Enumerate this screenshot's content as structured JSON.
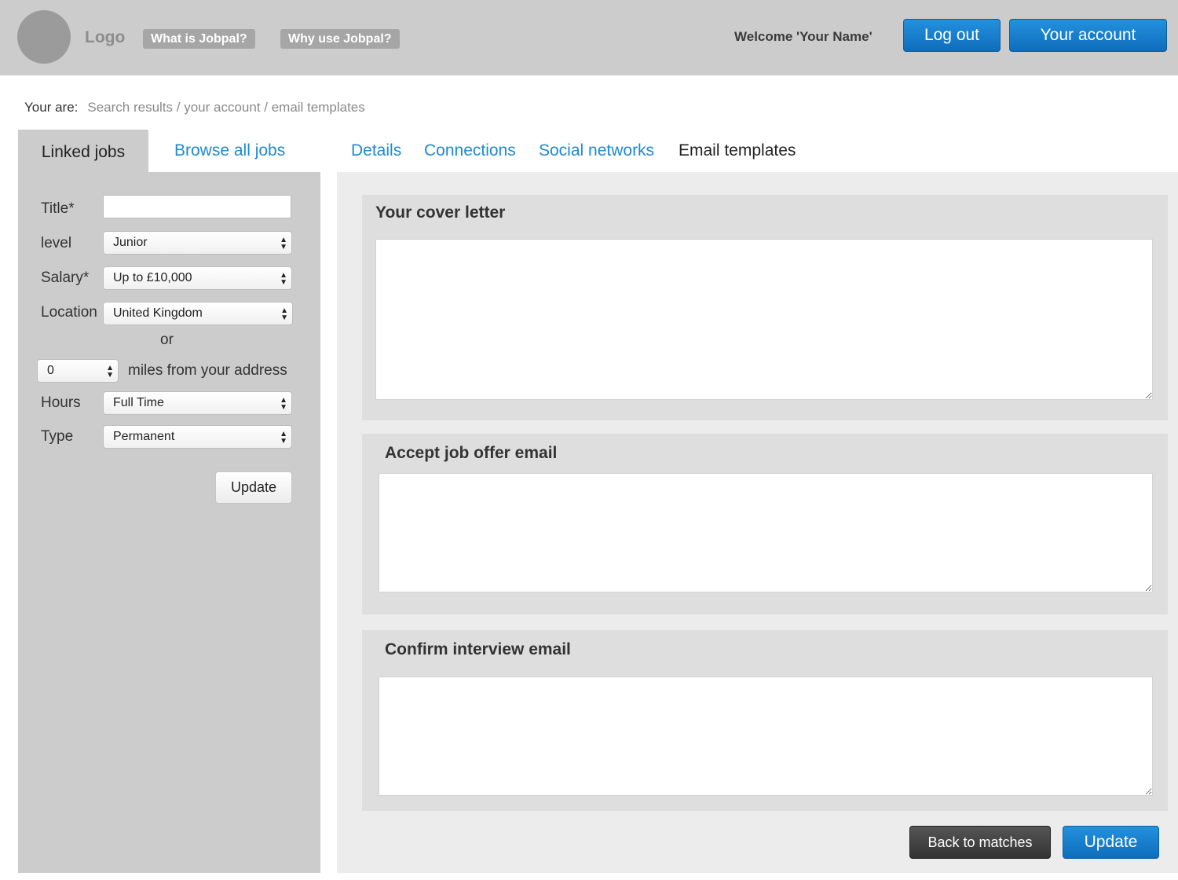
{
  "header": {
    "logo": "Logo",
    "nav": [
      "What is Jobpal?",
      "Why use Jobpal?"
    ],
    "welcome": "Welcome 'Your Name'",
    "logout": "Log out",
    "account": "Your account"
  },
  "breadcrumb": {
    "label": "Your are:",
    "path": "Search results / your account / email templates"
  },
  "left_tabs": [
    "Linked jobs",
    "Browse all jobs"
  ],
  "filters": {
    "title_label": "Title*",
    "title_value": "",
    "level_label": "level",
    "level_value": "Junior",
    "salary_label": "Salary*",
    "salary_value": "Up to £10,000",
    "location_label": "Location",
    "location_value": "United Kingdom",
    "or_text": "or",
    "miles_value": "0",
    "miles_label": "miles from your address",
    "hours_label": "Hours",
    "hours_value": "Full Time",
    "type_label": "Type",
    "type_value": "Permanent",
    "update": "Update"
  },
  "right_tabs": [
    "Details",
    "Connections",
    "Social networks",
    "Email templates"
  ],
  "active_tab": "Email templates",
  "sections": [
    {
      "title": "Your cover letter",
      "value": ""
    },
    {
      "title": "Accept job offer email",
      "value": ""
    },
    {
      "title": "Confirm interview email",
      "value": ""
    }
  ],
  "footer_buttons": {
    "back": "Back to matches",
    "update": "Update"
  },
  "colors": {
    "accent_blue": "#1d8ad0",
    "header_grey": "#cccccc",
    "panel_grey": "#ececec"
  }
}
